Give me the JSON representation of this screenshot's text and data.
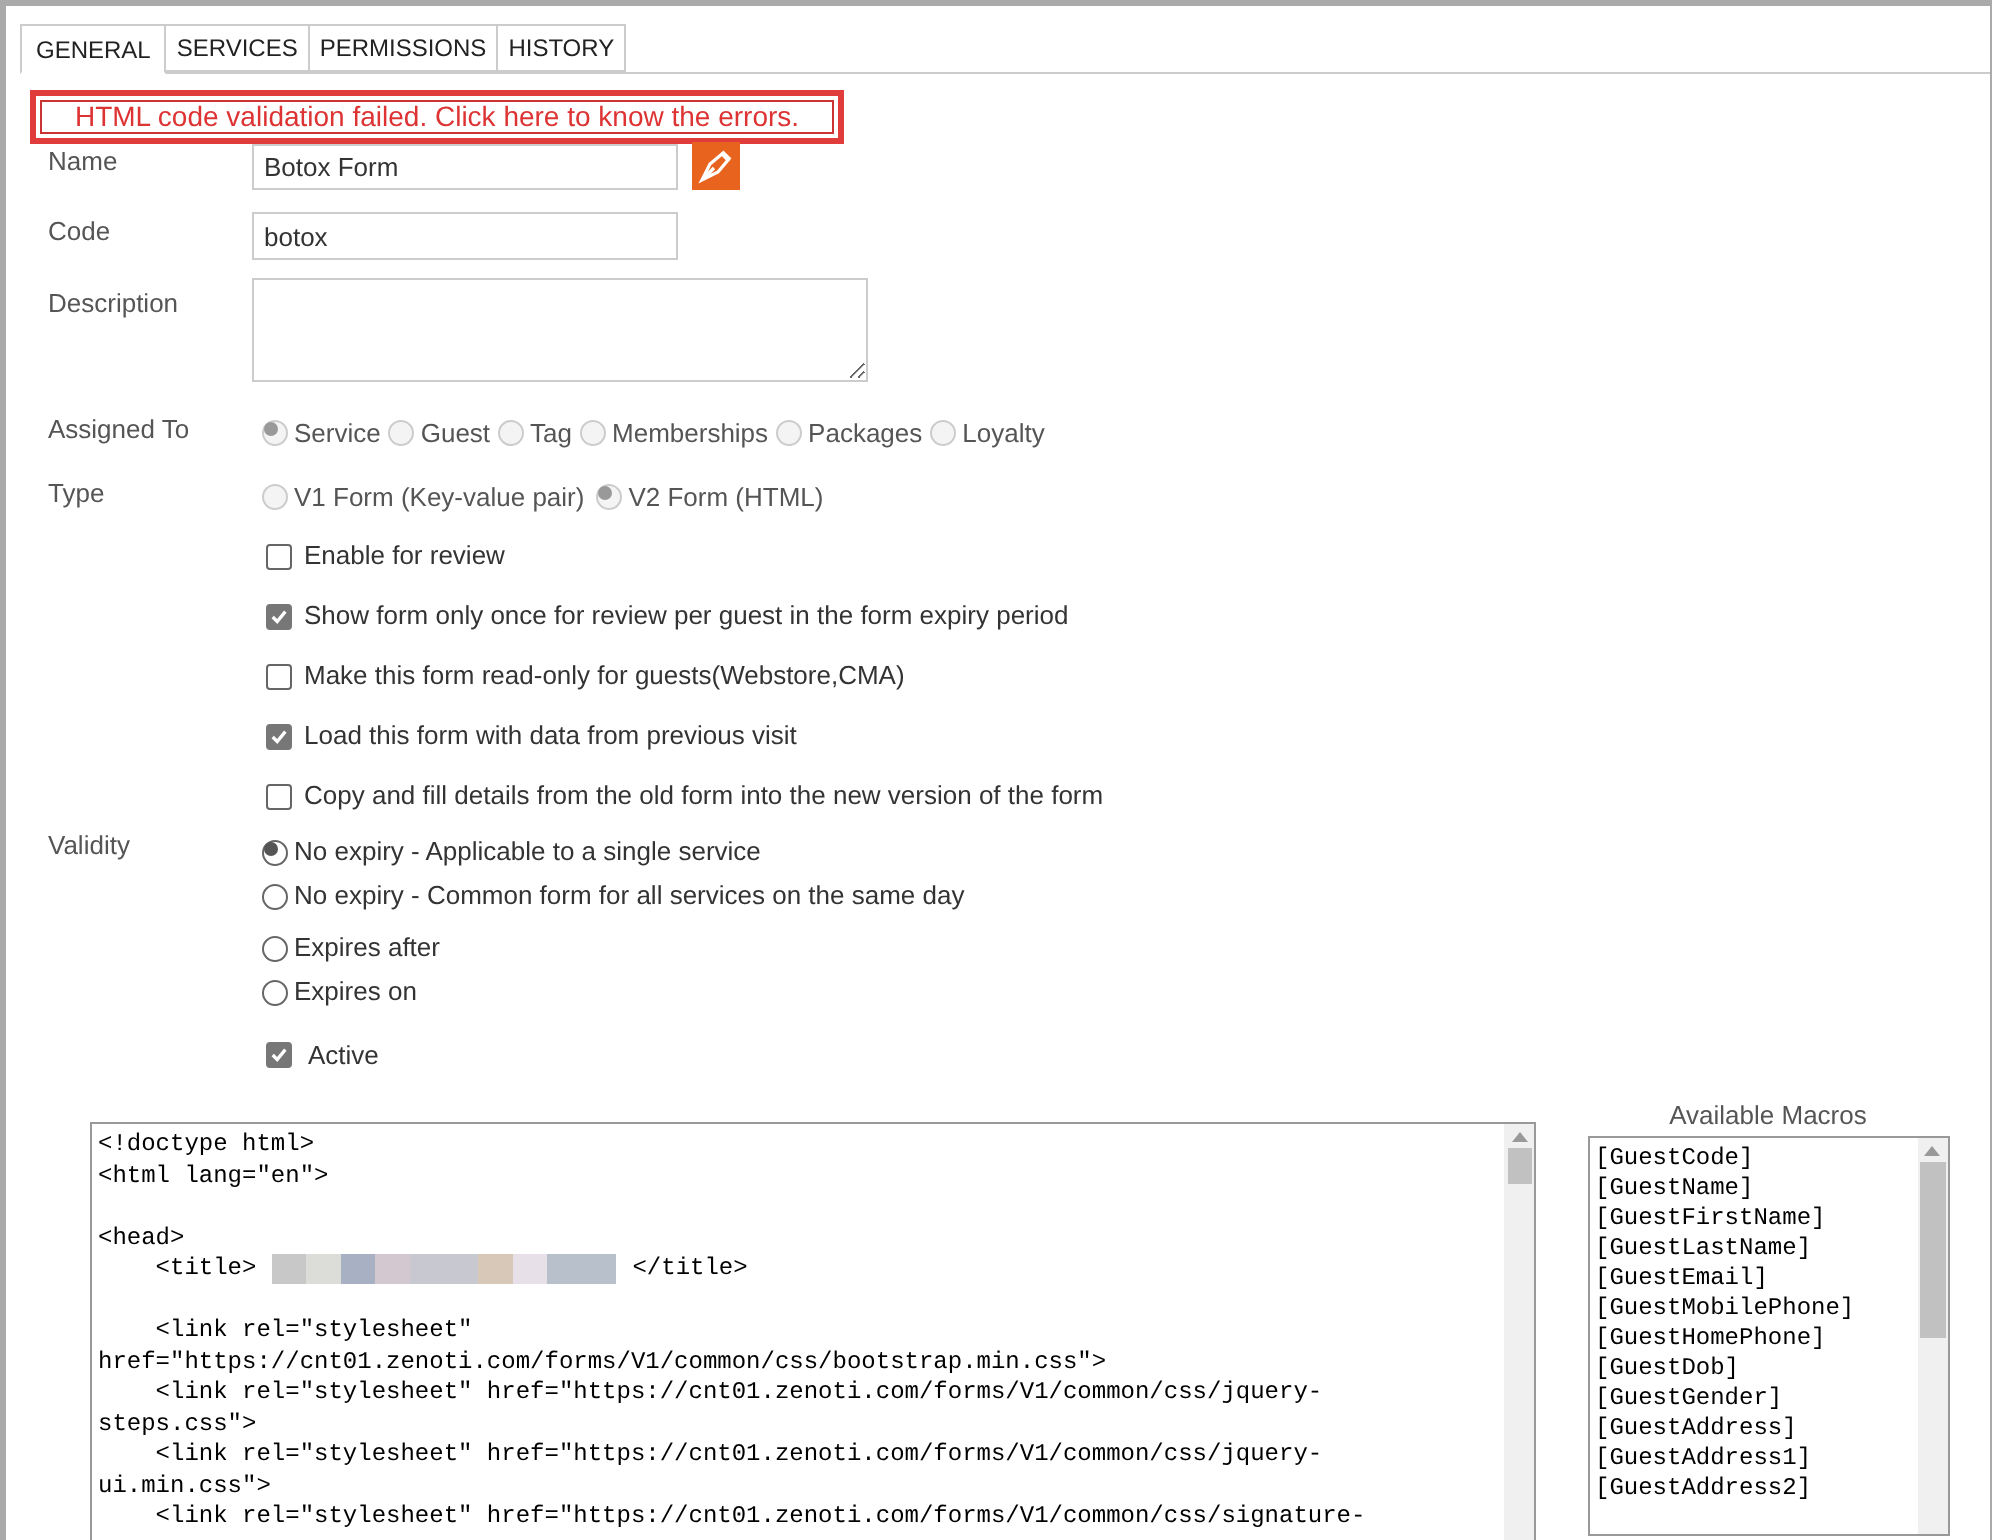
{
  "tabs": [
    {
      "label": "GENERAL",
      "selected": true
    },
    {
      "label": "SERVICES",
      "selected": false
    },
    {
      "label": "PERMISSIONS",
      "selected": false
    },
    {
      "label": "HISTORY",
      "selected": false
    }
  ],
  "error_banner": "HTML code validation failed. Click here to know the errors.",
  "name": {
    "label": "Name",
    "value": "Botox Form"
  },
  "code": {
    "label": "Code",
    "value": "botox"
  },
  "description": {
    "label": "Description"
  },
  "assigned_to": {
    "label": "Assigned To",
    "disabled": true,
    "options": [
      {
        "label": "Service",
        "selected": true
      },
      {
        "label": "Guest",
        "selected": false
      },
      {
        "label": "Tag",
        "selected": false
      },
      {
        "label": "Memberships",
        "selected": false
      },
      {
        "label": "Packages",
        "selected": false
      },
      {
        "label": "Loyalty",
        "selected": false
      }
    ]
  },
  "type": {
    "label": "Type",
    "disabled": true,
    "options": [
      {
        "label": "V1 Form (Key-value pair)",
        "selected": false
      },
      {
        "label": "V2 Form (HTML)",
        "selected": true
      }
    ]
  },
  "checkboxes": [
    {
      "label": "Enable for review",
      "checked": false
    },
    {
      "label": "Show form only once for review per guest in the form expiry period",
      "checked": true
    },
    {
      "label": "Make this form read-only for guests(Webstore,CMA)",
      "checked": false
    },
    {
      "label": "Load this form with data from previous visit",
      "checked": true
    },
    {
      "label": "Copy and fill details from the old form into the new version of the form",
      "checked": false
    }
  ],
  "validity": {
    "label": "Validity",
    "options": [
      {
        "label": "No expiry - Applicable to a single service",
        "selected": true
      },
      {
        "label": "No expiry - Common form for all services on the same day",
        "selected": false
      },
      {
        "label": "Expires after",
        "selected": false
      },
      {
        "label": "Expires on",
        "selected": false
      }
    ]
  },
  "active": {
    "label": "Active",
    "checked": true
  },
  "code_lines": [
    {
      "kind": "text",
      "text": "<!doctype html>"
    },
    {
      "kind": "text",
      "text": "<html lang=\"en\">"
    },
    {
      "kind": "blank"
    },
    {
      "kind": "text",
      "text": "<head>"
    },
    {
      "kind": "redacted",
      "before": "    <title>",
      "after": "</title>"
    },
    {
      "kind": "blank"
    },
    {
      "kind": "text",
      "text": "    <link rel=\"stylesheet\""
    },
    {
      "kind": "text",
      "text": "href=\"https://cnt01.zenoti.com/forms/V1/common/css/bootstrap.min.css\">"
    },
    {
      "kind": "text",
      "text": "    <link rel=\"stylesheet\" href=\"https://cnt01.zenoti.com/forms/V1/common/css/jquery-"
    },
    {
      "kind": "text",
      "text": "steps.css\">"
    },
    {
      "kind": "text",
      "text": "    <link rel=\"stylesheet\" href=\"https://cnt01.zenoti.com/forms/V1/common/css/jquery-"
    },
    {
      "kind": "text",
      "text": "ui.min.css\">"
    },
    {
      "kind": "text",
      "text": "    <link rel=\"stylesheet\" href=\"https://cnt01.zenoti.com/forms/V1/common/css/signature-"
    }
  ],
  "macros": {
    "title": "Available Macros",
    "items": [
      "[GuestCode]",
      "[GuestName]",
      "[GuestFirstName]",
      "[GuestLastName]",
      "[GuestEmail]",
      "[GuestMobilePhone]",
      "[GuestHomePhone]",
      "[GuestDob]",
      "[GuestGender]",
      "[GuestAddress]",
      "[GuestAddress1]",
      "[GuestAddress2]"
    ]
  }
}
